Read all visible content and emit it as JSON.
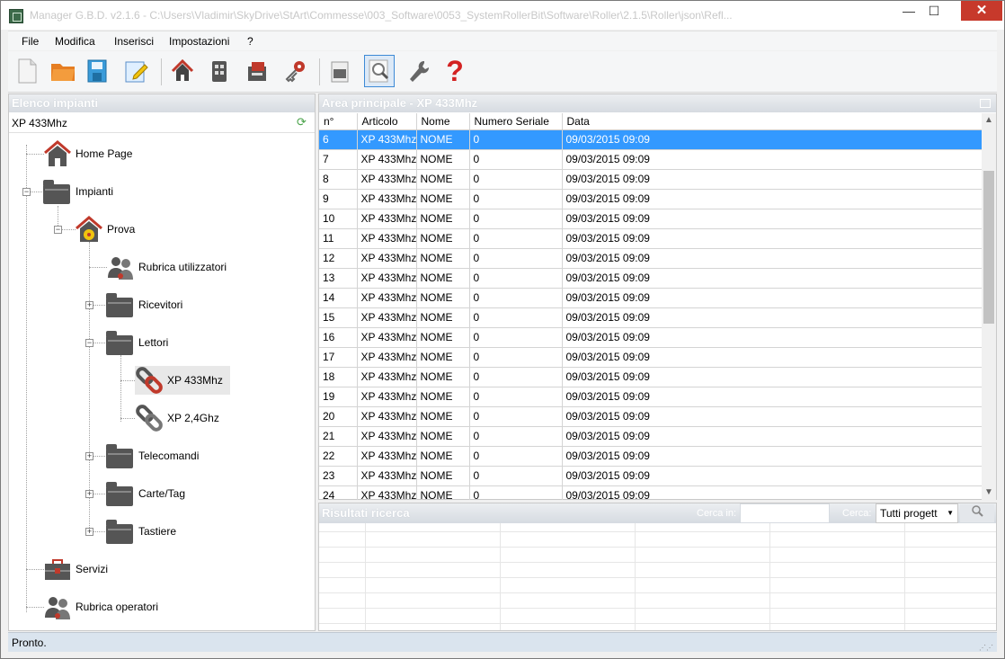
{
  "window": {
    "title": "Manager G.B.D. v2.1.6 - C:\\Users\\Vladimir\\SkyDrive\\StArt\\Commesse\\003_Software\\0053_SystemRollerBit\\Software\\Roller\\2.1.5\\Roller\\json\\Refl...",
    "minimize": "—",
    "maximize": "☐",
    "close": "✕"
  },
  "menu": [
    "File",
    "Modifica",
    "Inserisci",
    "Impostazioni",
    "?"
  ],
  "toolbar": {
    "icons": [
      "new-file-icon",
      "open-folder-icon",
      "save-icon",
      "edit-icon",
      "home-icon",
      "receiver-icon",
      "card-reader-icon",
      "key-tag-icon",
      "archive-icon",
      "search-icon",
      "wrench-icon",
      "help-icon"
    ]
  },
  "left": {
    "header": "Elenco impianti",
    "selected": "XP 433Mhz",
    "tree": {
      "home": "Home Page",
      "impianti": "Impianti",
      "prova": "Prova",
      "rubrica_utilizzatori": "Rubrica utilizzatori",
      "ricevitori": "Ricevitori",
      "lettori": "Lettori",
      "xp433": "XP 433Mhz",
      "xp24": "XP 2,4Ghz",
      "telecomandi": "Telecomandi",
      "carte": "Carte/Tag",
      "tastiere": "Tastiere",
      "servizi": "Servizi",
      "rubrica_operatori": "Rubrica operatori"
    }
  },
  "main": {
    "header": "Area principale - XP 433Mhz",
    "columns": [
      "n°",
      "Articolo",
      "Nome",
      "Numero Seriale",
      "Data"
    ],
    "rows": [
      [
        "6",
        "XP 433Mhz",
        "NOME",
        "0",
        "09/03/2015 09:09"
      ],
      [
        "7",
        "XP 433Mhz",
        "NOME",
        "0",
        "09/03/2015 09:09"
      ],
      [
        "8",
        "XP 433Mhz",
        "NOME",
        "0",
        "09/03/2015 09:09"
      ],
      [
        "9",
        "XP 433Mhz",
        "NOME",
        "0",
        "09/03/2015 09:09"
      ],
      [
        "10",
        "XP 433Mhz",
        "NOME",
        "0",
        "09/03/2015 09:09"
      ],
      [
        "11",
        "XP 433Mhz",
        "NOME",
        "0",
        "09/03/2015 09:09"
      ],
      [
        "12",
        "XP 433Mhz",
        "NOME",
        "0",
        "09/03/2015 09:09"
      ],
      [
        "13",
        "XP 433Mhz",
        "NOME",
        "0",
        "09/03/2015 09:09"
      ],
      [
        "14",
        "XP 433Mhz",
        "NOME",
        "0",
        "09/03/2015 09:09"
      ],
      [
        "15",
        "XP 433Mhz",
        "NOME",
        "0",
        "09/03/2015 09:09"
      ],
      [
        "16",
        "XP 433Mhz",
        "NOME",
        "0",
        "09/03/2015 09:09"
      ],
      [
        "17",
        "XP 433Mhz",
        "NOME",
        "0",
        "09/03/2015 09:09"
      ],
      [
        "18",
        "XP 433Mhz",
        "NOME",
        "0",
        "09/03/2015 09:09"
      ],
      [
        "19",
        "XP 433Mhz",
        "NOME",
        "0",
        "09/03/2015 09:09"
      ],
      [
        "20",
        "XP 433Mhz",
        "NOME",
        "0",
        "09/03/2015 09:09"
      ],
      [
        "21",
        "XP 433Mhz",
        "NOME",
        "0",
        "09/03/2015 09:09"
      ],
      [
        "22",
        "XP 433Mhz",
        "NOME",
        "0",
        "09/03/2015 09:09"
      ],
      [
        "23",
        "XP 433Mhz",
        "NOME",
        "0",
        "09/03/2015 09:09"
      ],
      [
        "24",
        "XP 433Mhz",
        "NOME",
        "0",
        "09/03/2015 09:09"
      ]
    ],
    "selected_row": "6"
  },
  "search": {
    "header": "Risultati ricerca",
    "cerca_in_label": "Cerca in:",
    "cerca_label": "Cerca:",
    "scope_value": "Tutti progett"
  },
  "status": {
    "text": "Pronto."
  },
  "colors": {
    "selection": "#3399ff",
    "status_bar": "#dae4ee",
    "close_button": "#c7392b"
  }
}
